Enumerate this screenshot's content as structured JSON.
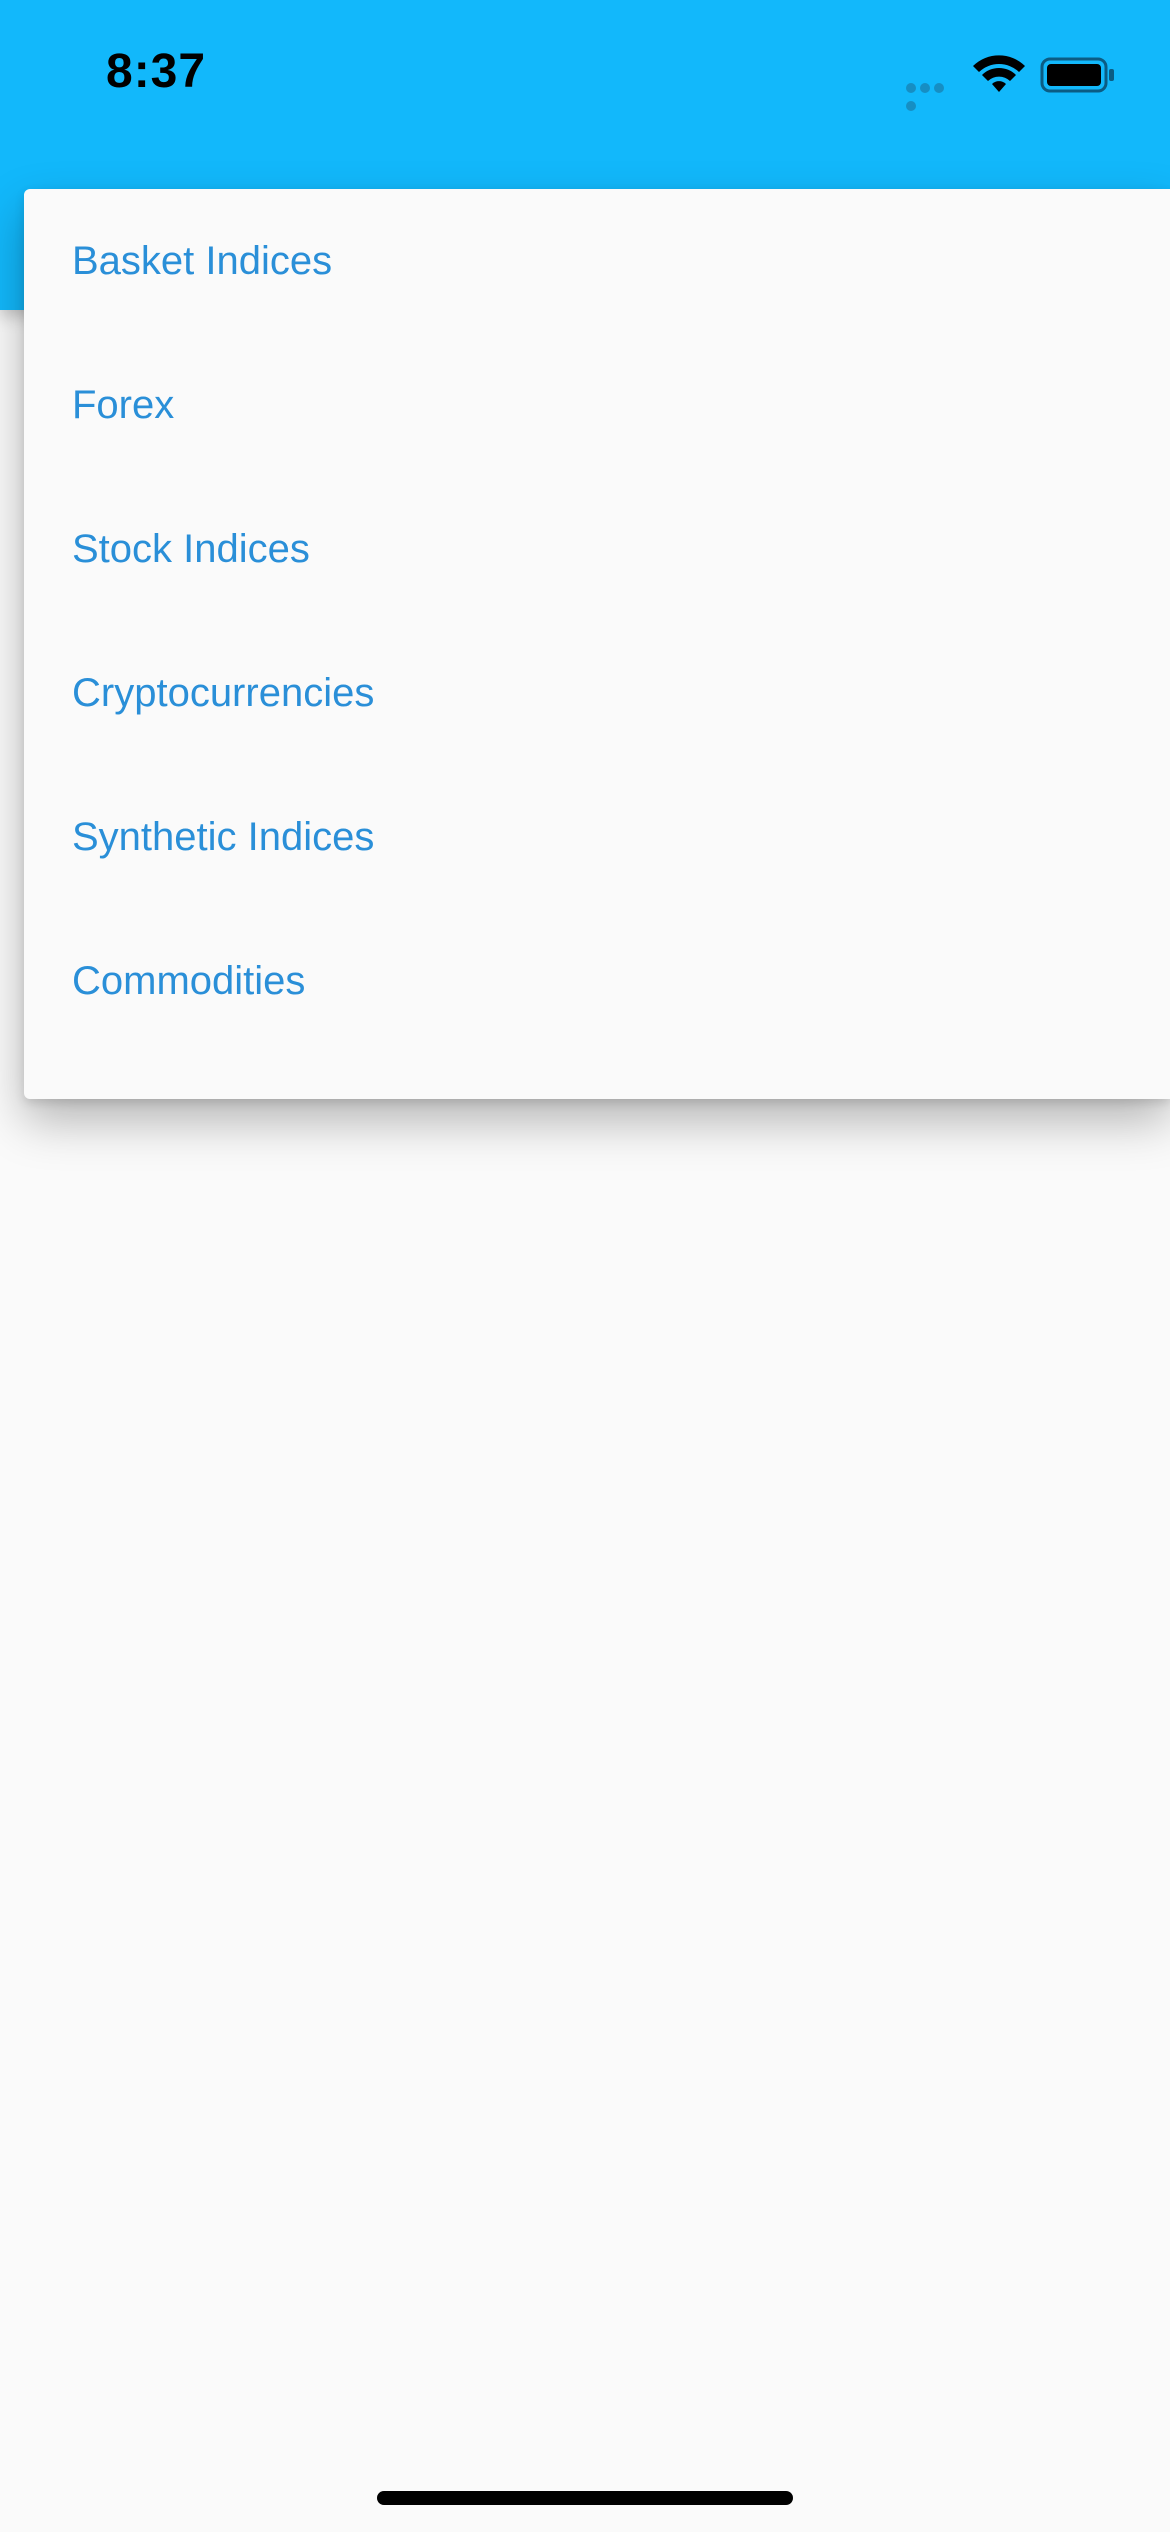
{
  "status_bar": {
    "time": "8:37",
    "icons": [
      "cellular-signal-icon",
      "wifi-icon",
      "battery-icon"
    ]
  },
  "colors": {
    "app_bar": "#12b8fb",
    "menu_text": "#2a8fd8",
    "background": "#fafafa"
  },
  "menu": {
    "items": [
      {
        "label": "Basket Indices"
      },
      {
        "label": "Forex"
      },
      {
        "label": "Stock Indices"
      },
      {
        "label": "Cryptocurrencies"
      },
      {
        "label": "Synthetic Indices"
      },
      {
        "label": "Commodities"
      }
    ]
  }
}
